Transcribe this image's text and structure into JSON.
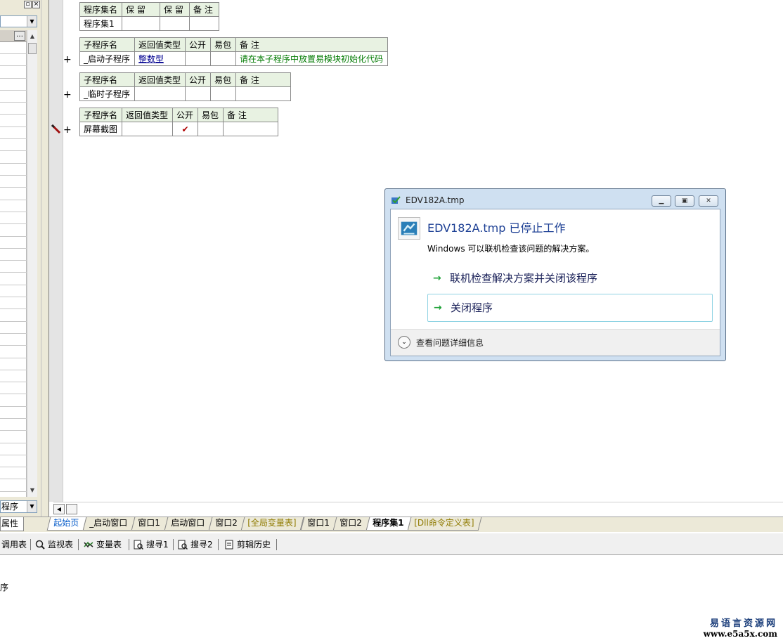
{
  "left_panel": {
    "bottom_combo_text": "程序",
    "props_tab_label": "属性"
  },
  "editor": {
    "assembly_table": {
      "headers": [
        "程序集名",
        "保 留",
        "保 留",
        "备 注"
      ],
      "row": [
        "程序集1",
        "",
        "",
        ""
      ]
    },
    "sub1": {
      "headers": [
        "子程序名",
        "返回值类型",
        "公开",
        "易包",
        "备 注"
      ],
      "row": [
        "_启动子程序",
        "整数型",
        "",
        "",
        "请在本子程序中放置易模块初始化代码"
      ]
    },
    "sub2": {
      "headers": [
        "子程序名",
        "返回值类型",
        "公开",
        "易包",
        "备 注"
      ],
      "row": [
        "_临时子程序",
        "",
        "",
        "",
        ""
      ]
    },
    "sub3": {
      "headers": [
        "子程序名",
        "返回值类型",
        "公开",
        "易包",
        "备 注"
      ],
      "row": [
        "屏幕截图",
        "",
        "✔",
        "",
        ""
      ]
    },
    "expand_symbol": "+"
  },
  "tabs": [
    {
      "label": "起始页",
      "style": "first"
    },
    {
      "label": "_启动窗口",
      "style": ""
    },
    {
      "label": "窗口1",
      "style": ""
    },
    {
      "label": "启动窗口",
      "style": ""
    },
    {
      "label": "窗口2",
      "style": ""
    },
    {
      "label": "[全局变量表]",
      "style": "yellow"
    },
    {
      "label": "窗口1",
      "style": ""
    },
    {
      "label": "窗口2",
      "style": ""
    },
    {
      "label": "程序集1",
      "style": "active"
    },
    {
      "label": "[Dll命令定义表]",
      "style": "yellow"
    }
  ],
  "toolbar": {
    "call_table": "调用表",
    "watch_table": "监视表",
    "var_table": "变量表",
    "search1": "搜寻1",
    "search2": "搜寻2",
    "clip_history": "剪辑历史"
  },
  "output": {
    "line": "序"
  },
  "watermark": {
    "line1": "易语言资源网",
    "line2": "www.e5a5x.com"
  },
  "dialog": {
    "title": "EDV182A.tmp",
    "heading": "EDV182A.tmp 已停止工作",
    "subtext": "Windows 可以联机检查该问题的解决方案。",
    "cmd_check": "联机检查解决方案并关闭该程序",
    "cmd_close": "关闭程序",
    "details": "查看问题详细信息",
    "colors": {
      "heading": "#1c3f94",
      "arrow": "#21a33a",
      "frame": "#cfe0f1"
    }
  },
  "icons": {
    "arrow": "→",
    "chevron": "⌄",
    "checkmark": "✔"
  }
}
